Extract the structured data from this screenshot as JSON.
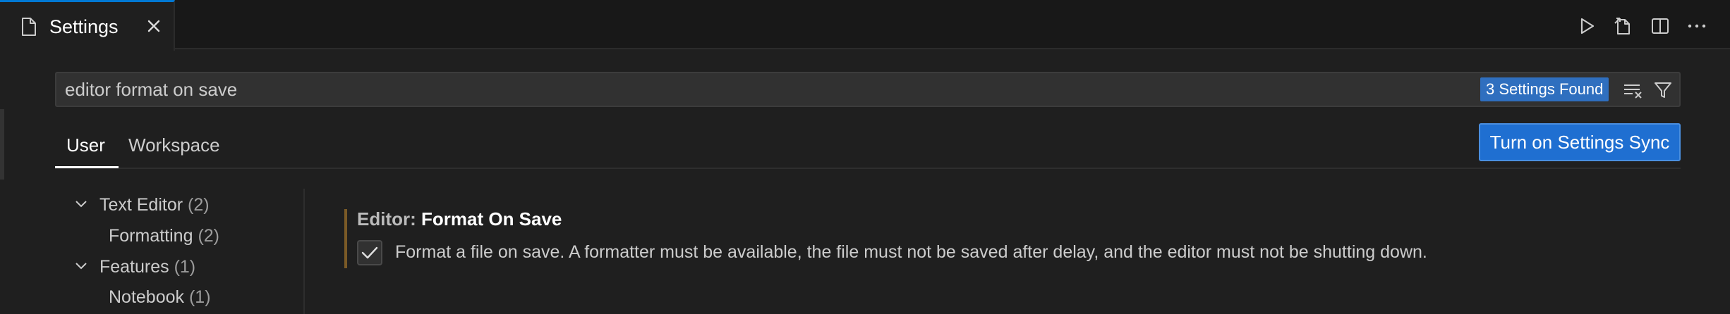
{
  "tab": {
    "label": "Settings"
  },
  "search": {
    "value": "editor format on save",
    "results_badge": "3 Settings Found"
  },
  "scope_tabs": {
    "user": "User",
    "workspace": "Workspace"
  },
  "sync_button": {
    "label": "Turn on Settings Sync"
  },
  "toc": [
    {
      "label": "Text Editor",
      "count": "(2)",
      "expanded": true
    },
    {
      "label": "Formatting",
      "count": "(2)"
    },
    {
      "label": "Features",
      "count": "(1)",
      "expanded": true
    },
    {
      "label": "Notebook",
      "count": "(1)"
    }
  ],
  "setting": {
    "category": "Editor: ",
    "key": "Format On Save",
    "checked": true,
    "description": "Format a file on save. A formatter must be available, the file must not be saved after delay, and the editor must not be shutting down."
  },
  "colors": {
    "accent": "#0078d4",
    "button": "#1f6fd1",
    "badge": "#2f6fbf",
    "background": "#1f1f1f"
  },
  "icons": [
    "file-icon",
    "close-icon",
    "run-icon",
    "open-json-icon",
    "split-editor-icon",
    "more-actions-icon",
    "clear-filter-icon",
    "filter-icon",
    "chevron-down-icon",
    "check-icon"
  ]
}
